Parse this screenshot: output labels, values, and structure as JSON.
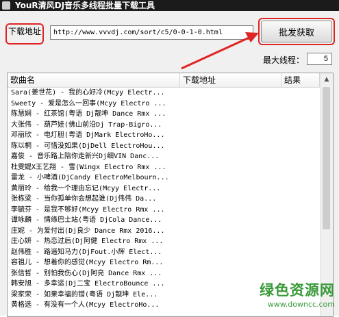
{
  "window": {
    "title": "YouR清风DJ音乐多线程批量下载工具"
  },
  "toolbar": {
    "url_label": "下载地址",
    "url_value": "http://www.vvvdj.com/sort/c5/0-0-1-0.html",
    "fetch_button": "批发获取",
    "threads_label": "最大线程：",
    "threads_value": "5"
  },
  "list": {
    "columns": [
      "歌曲名",
      "下载地址",
      "结果"
    ],
    "rows": [
      "Sara(姜世花) - 我的心好冷(Mcyy Electr...",
      "Sweety - 爱是怎么一回事(Mcyy Electro ...",
      "陈慧娴 - 红茶馆(粤语 Dj靓坤 Dance Rmx ...",
      "大张伟 - 葫芦娃(佛山前沿Dj Trap-Bigro...",
      "邓丽欣 - 电灯胆(粤语 DjMark ElectroHo...",
      "陈以桐 - 可惜没如果(DjDell ElectroHou...",
      "嘉俊 - 音乐路上陪你走新兴Dj细VIN Danc...",
      "杜雯媞X王艺翔 - 雪(Wingx Electro Rmx ...",
      "雷龙 - 小啤酒(DjCandy ElectroMelbourn...",
      "黄丽玲 - 给我一个理由忘记(Mcyy Electr...",
      "张栋梁 - 当你孤单你会想起谁(Dj伟伟 Da...",
      "李毓芬 - 是我不够好(Mcyy Electro Rmx ...",
      "谭咏麟 - 情缘巴士站(粤语 DjCola Dance...",
      "庄妮 - 为爱付出(Dj良少 Dance Rmx 2016...",
      "庄心妍 - 热恋过后(Dj阿健 Electro Rmx ...",
      "赵伟胜 - 路遥知马力(DjFout.小辉 Elect...",
      "容祖儿 - 想着你的感觉(Mcyy Electro Rm...",
      "张信哲 - 别怕我伤心(Dj阿亮 Dance Rmx ...",
      "韩安旭 - 多幸运(Dj二宝 ElectroBounce ...",
      "梁家荣 - 如果幸福的错(粤语 Dj靓坤 Ele...",
      "黄格选 - 有没有一个人(Mcyy ElectroHo..."
    ]
  },
  "watermark": {
    "name": "绿色资源网",
    "url": "www.downcc.com"
  },
  "colors": {
    "highlight": "#e02424",
    "watermark": "#3a9a3a",
    "titlebar": "#1b1b1b"
  }
}
